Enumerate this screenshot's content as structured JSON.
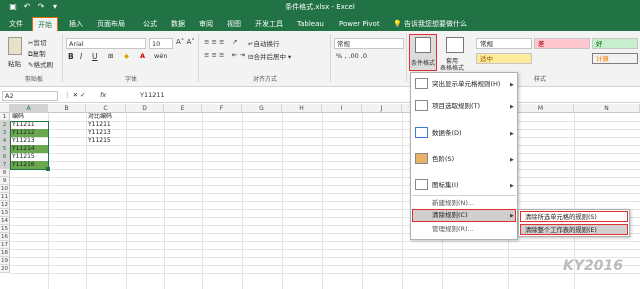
{
  "window": {
    "title": "条件格式.xlsx - Excel"
  },
  "tabs": [
    "文件",
    "开始",
    "插入",
    "页面布局",
    "公式",
    "数据",
    "审阅",
    "视图",
    "开发工具",
    "Tableau",
    "Power Pivot"
  ],
  "tell_me": "告诉我您想要做什么",
  "clipboard": {
    "paste": "粘贴",
    "cut": "剪切",
    "copy": "复制",
    "format_painter": "格式刷",
    "group": "剪贴板"
  },
  "font": {
    "name": "Arial",
    "size": "10",
    "group": "字体"
  },
  "alignment": {
    "wrap": "自动换行",
    "merge": "合并后居中",
    "group": "对齐方式"
  },
  "number": {
    "format": "常规"
  },
  "styles": {
    "cond_format": "条件格式",
    "table_format_1": "套用",
    "table_format_2": "表格格式",
    "normal": "常规",
    "bad": "差",
    "good": "好",
    "neutral": "适中",
    "calc": "计算",
    "group": "样式"
  },
  "formula_bar": {
    "name_box": "A2",
    "fx": "fx",
    "value": "Y11211"
  },
  "columns": [
    "A",
    "B",
    "C",
    "D",
    "E",
    "F",
    "G",
    "H",
    "I",
    "J",
    "K",
    "L",
    "M",
    "N"
  ],
  "rows": [
    "1",
    "2",
    "3",
    "4",
    "5",
    "6",
    "7",
    "8",
    "9",
    "10",
    "11",
    "12",
    "13",
    "14",
    "15",
    "16",
    "17",
    "18",
    "19",
    "20"
  ],
  "cells": {
    "colA": [
      "编码",
      "Y11211",
      "Y11212",
      "Y11213",
      "Y11214",
      "Y11215",
      "Y11216"
    ],
    "colC": [
      "对比编码",
      "Y11211",
      "Y11213",
      "Y11215"
    ]
  },
  "menu": {
    "items": [
      {
        "label": "突出显示单元格规则(H)",
        "arrow": "▶"
      },
      {
        "label": "项目选取规则(T)",
        "arrow": "▶"
      },
      {
        "label": "数据条(D)",
        "arrow": "▶"
      },
      {
        "label": "色阶(S)",
        "arrow": "▶"
      },
      {
        "label": "图标集(I)",
        "arrow": "▶"
      },
      {
        "label": "新建规则(N)...",
        "arrow": ""
      },
      {
        "label": "清除规则(C)",
        "arrow": "▶"
      },
      {
        "label": "管理规则(R)...",
        "arrow": ""
      }
    ]
  },
  "submenu": {
    "items": [
      "清除所选单元格的规则(S)",
      "清除整个工作表的规则(E)"
    ]
  },
  "watermark": "KY2016",
  "colors": {
    "excel_green": "#217346",
    "highlight": "#6aa84f",
    "selection_red": "#e03030"
  }
}
